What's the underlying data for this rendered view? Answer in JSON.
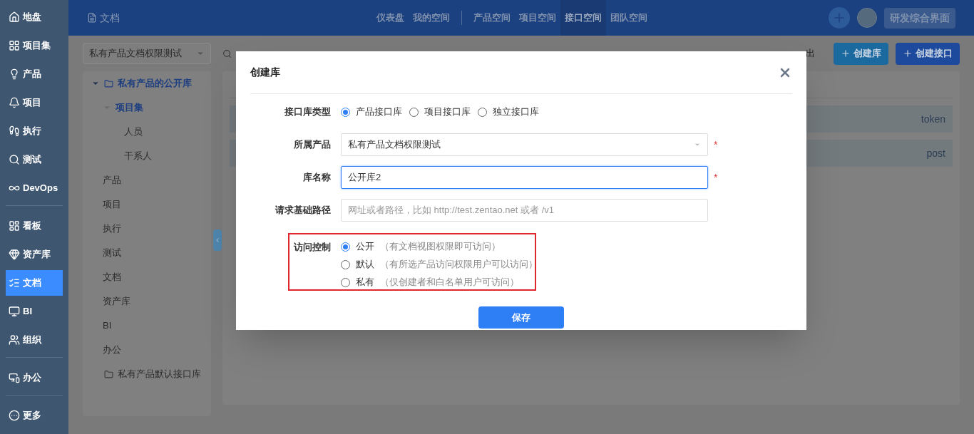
{
  "sidebar": {
    "groups": [
      [
        {
          "label": "地盘",
          "selected": false
        },
        {
          "label": "项目集",
          "selected": false
        },
        {
          "label": "产品",
          "selected": false
        },
        {
          "label": "项目",
          "selected": false
        },
        {
          "label": "执行",
          "selected": false
        },
        {
          "label": "测试",
          "selected": false
        },
        {
          "label": "DevOps",
          "selected": false
        }
      ],
      [
        {
          "label": "看板",
          "selected": false
        },
        {
          "label": "资产库",
          "selected": false
        },
        {
          "label": "文档",
          "selected": true
        },
        {
          "label": "BI",
          "selected": false
        },
        {
          "label": "组织",
          "selected": false
        }
      ],
      [
        {
          "label": "办公",
          "selected": false
        }
      ],
      [
        {
          "label": "更多",
          "selected": false
        }
      ]
    ]
  },
  "header": {
    "title": "文档",
    "nav_groups": [
      [
        {
          "label": "仪表盘",
          "selected": false
        },
        {
          "label": "我的空间",
          "selected": false
        }
      ],
      [
        {
          "label": "产品空间",
          "selected": false
        },
        {
          "label": "项目空间",
          "selected": false
        },
        {
          "label": "接口空间",
          "selected": true
        },
        {
          "label": "团队空间",
          "selected": false
        }
      ]
    ],
    "workspace_button": "研发综合界面"
  },
  "toolbar": {
    "product_select": "私有产品文档权限测试",
    "visible_action": "出",
    "buttons": [
      "创建库",
      "创建接口"
    ]
  },
  "tree": [
    {
      "label": "私有产品的公开库",
      "kind": "library",
      "selected": true,
      "expanded": true,
      "children": [
        {
          "label": "项目集",
          "kind": "module",
          "selected": true,
          "expanded": true,
          "children": [
            {
              "label": "人员",
              "kind": "module",
              "selected": false
            },
            {
              "label": "干系人",
              "kind": "module",
              "selected": false
            }
          ]
        },
        {
          "label": "产品",
          "kind": "module",
          "selected": false
        },
        {
          "label": "项目",
          "kind": "module",
          "selected": false
        },
        {
          "label": "执行",
          "kind": "module",
          "selected": false
        },
        {
          "label": "测试",
          "kind": "module",
          "selected": false
        },
        {
          "label": "文档",
          "kind": "module",
          "selected": false
        },
        {
          "label": "资产库",
          "kind": "module",
          "selected": false
        },
        {
          "label": "BI",
          "kind": "module",
          "selected": false
        },
        {
          "label": "办公",
          "kind": "module",
          "selected": false
        }
      ]
    },
    {
      "label": "私有产品默认接口库",
      "kind": "library",
      "selected": false
    }
  ],
  "content": {
    "rows": [
      "token",
      "post"
    ]
  },
  "dialog": {
    "title": "创建库",
    "type_field": {
      "label": "接口库类型",
      "options": [
        {
          "label": "产品接口库",
          "selected": true
        },
        {
          "label": "项目接口库",
          "selected": false
        },
        {
          "label": "独立接口库",
          "selected": false
        }
      ]
    },
    "product_field": {
      "label": "所属产品",
      "value": "私有产品文档权限测试",
      "required_mark": "*"
    },
    "name_field": {
      "label": "库名称",
      "value": "公开库2",
      "required_mark": "*"
    },
    "path_field": {
      "label": "请求基础路径",
      "placeholder": "网址或者路径，比如 http://test.zentao.net 或者 /v1"
    },
    "access_field": {
      "label": "访问控制",
      "highlighted": true,
      "options": [
        {
          "label": "公开",
          "hint": "（有文档视图权限即可访问）",
          "selected": true
        },
        {
          "label": "默认",
          "hint": "（有所选产品访问权限用户可以访问）",
          "selected": false
        },
        {
          "label": "私有",
          "hint": "（仅创建者和白名单用户可访问）",
          "selected": false
        }
      ]
    },
    "save_button": "保存"
  }
}
